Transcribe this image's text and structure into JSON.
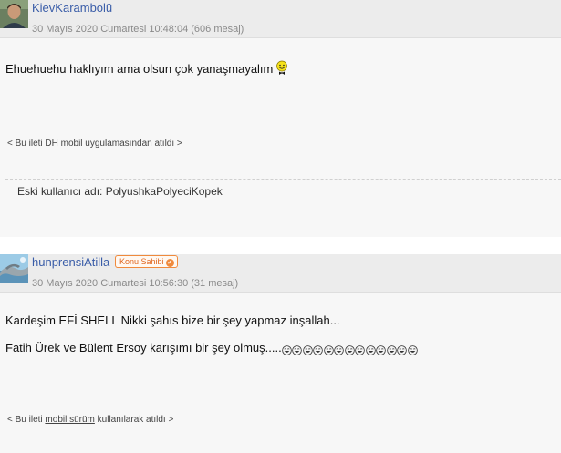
{
  "posts": [
    {
      "username": "KievKarambolü",
      "timestamp": "30 Mayıs 2020 Cumartesi 10:48:04 (606 mesaj)",
      "message_lines": [
        "Ehuehuehu haklıyım ama olsun çok yanaşmayalım"
      ],
      "footer_note": "< Bu ileti DH mobil uygulamasından atıldı >",
      "signature": "Eski kullanıcı adı: PolyushkaPolyeciKopek",
      "emoticon": "smiley-tuxedo-icon"
    },
    {
      "username": "hunprensiAtilla",
      "badge": "Konu Sahibi",
      "timestamp": "30 Mayıs 2020 Cumartesi 10:56:30 (31 mesaj)",
      "message_lines": [
        "Kardeşim EFİ SHELL Nikki şahıs bize bir şey yapmaz inşallah...",
        "Fatih Ürek ve Bülent Ersoy karışımı bir şey olmuş....."
      ],
      "emoji_count": 13,
      "emoticon": "laughing-face-icon",
      "footer_prefix": "< Bu ileti ",
      "footer_link": "mobil sürüm",
      "footer_suffix": " kullanılarak atıldı >"
    }
  ],
  "colors": {
    "username": "#3a5da8",
    "badge": "#e0661f",
    "header_bg": "#ececec",
    "post_bg": "#f7f7f7"
  }
}
